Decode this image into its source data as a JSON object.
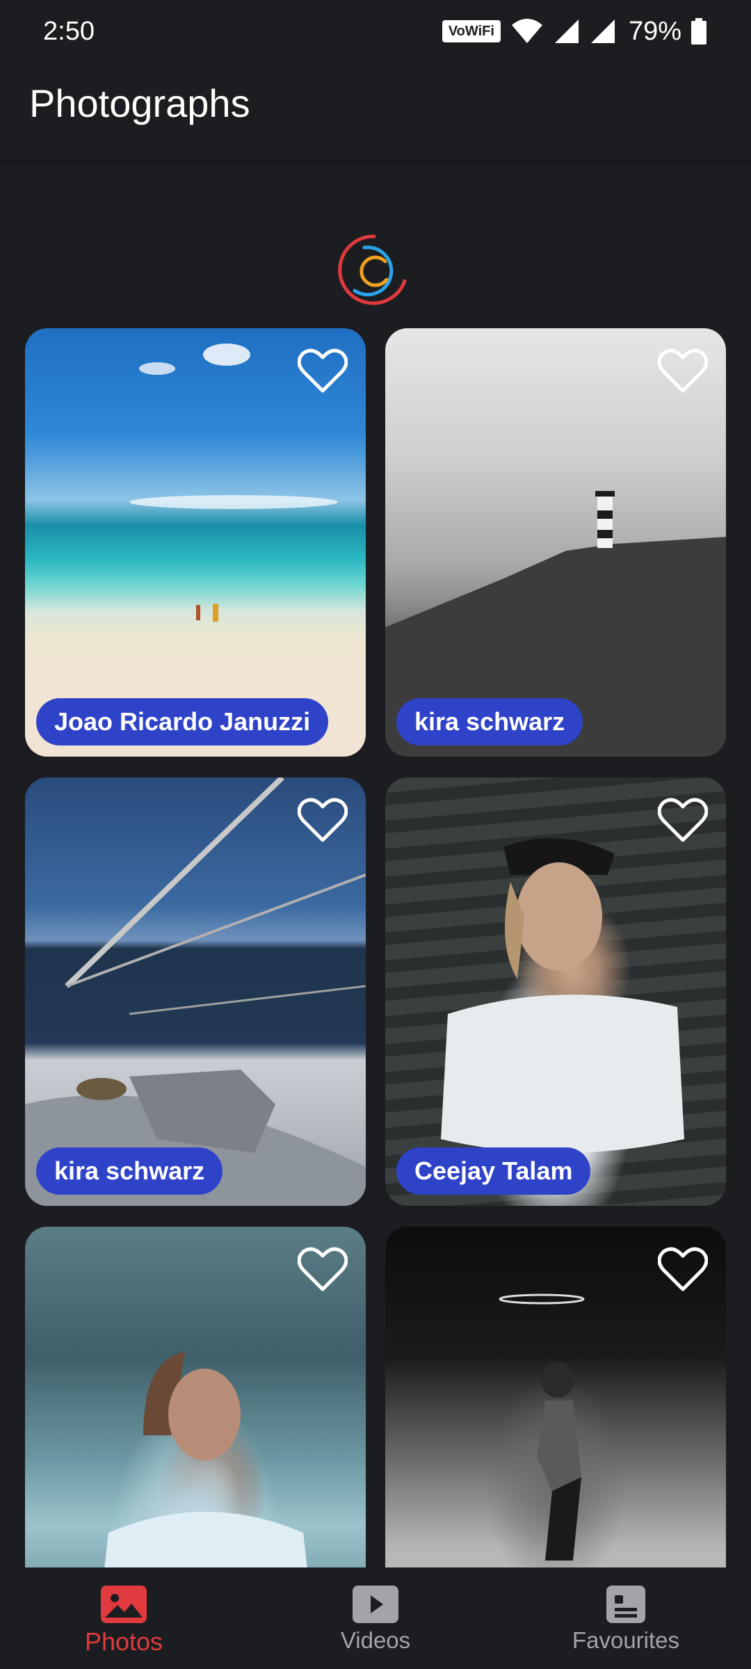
{
  "status_bar": {
    "time": "2:50",
    "wifi_badge": "VoWiFi",
    "battery": "79%"
  },
  "app_bar": {
    "title": "Photographs"
  },
  "photos": [
    {
      "author": "Joao Ricardo Januzzi",
      "favourite": false
    },
    {
      "author": "kira schwarz",
      "favourite": false
    },
    {
      "author": "kira schwarz",
      "favourite": false
    },
    {
      "author": "Ceejay Talam",
      "favourite": false
    },
    {
      "author": "",
      "favourite": false
    },
    {
      "author": "",
      "favourite": false
    }
  ],
  "bottom_nav": {
    "items": [
      {
        "label": "Photos",
        "icon": "image-icon",
        "active": true
      },
      {
        "label": "Videos",
        "icon": "play-icon",
        "active": false
      },
      {
        "label": "Favourites",
        "icon": "favourites-icon",
        "active": false
      }
    ]
  },
  "colors": {
    "background": "#1c1d21",
    "chip": "#2f43c9",
    "active_nav": "#e03a3e",
    "inactive_nav": "#a4a4a8",
    "loader_outer": "#e03a3e",
    "loader_middle": "#2aa4e8",
    "loader_inner": "#f2a01e"
  }
}
